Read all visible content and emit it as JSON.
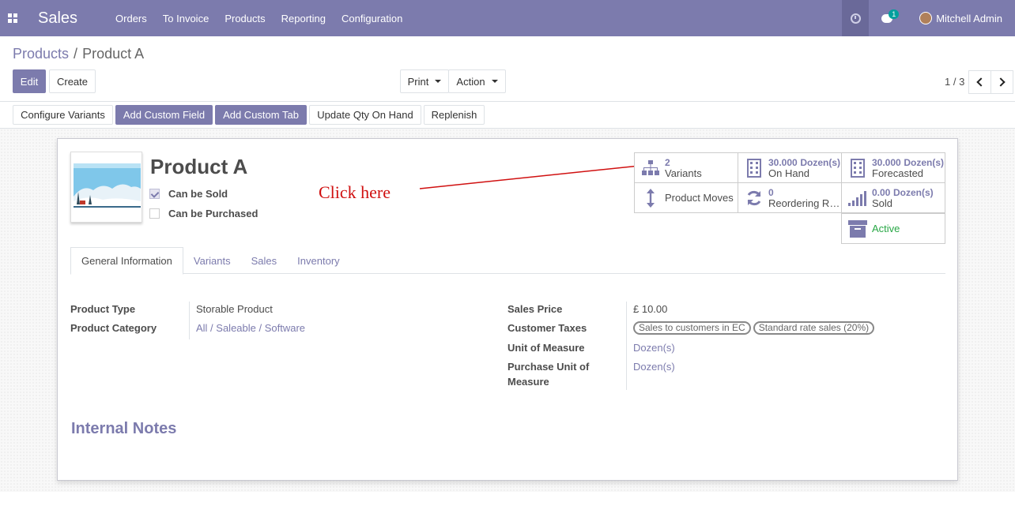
{
  "navbar": {
    "app_title": "Sales",
    "menu": [
      "Orders",
      "To Invoice",
      "Products",
      "Reporting",
      "Configuration"
    ],
    "chat_count": "1",
    "user_name": "Mitchell Admin"
  },
  "breadcrumb": {
    "parent": "Products",
    "separator": "/",
    "current": "Product A"
  },
  "buttons": {
    "edit": "Edit",
    "create": "Create",
    "print": "Print",
    "action": "Action"
  },
  "pager": {
    "text": "1 / 3"
  },
  "action_buttons": {
    "configure_variants": "Configure Variants",
    "add_custom_field": "Add Custom Field",
    "add_custom_tab": "Add Custom Tab",
    "update_qty": "Update Qty On Hand",
    "replenish": "Replenish"
  },
  "product": {
    "name": "Product A",
    "can_be_sold_label": "Can be Sold",
    "can_be_sold": true,
    "can_be_purchased_label": "Can be Purchased",
    "can_be_purchased": false
  },
  "annotation": {
    "text": "Click here"
  },
  "smart_buttons": {
    "variants": {
      "value": "2",
      "label": "Variants"
    },
    "on_hand": {
      "value": "30.000",
      "unit": "Dozen(s)",
      "label": "On Hand"
    },
    "forecasted": {
      "value": "30.000",
      "unit": "Dozen(s)",
      "label": "Forecasted"
    },
    "product_moves": {
      "label": "Product Moves"
    },
    "reordering": {
      "value": "0",
      "label": "Reordering Rules"
    },
    "sold": {
      "value": "0.00",
      "unit": "Dozen(s)",
      "label": "Sold"
    },
    "active": {
      "label": "Active"
    }
  },
  "tabs": [
    "General Information",
    "Variants",
    "Sales",
    "Inventory"
  ],
  "fields": {
    "product_type": {
      "label": "Product Type",
      "value": "Storable Product"
    },
    "product_category": {
      "label": "Product Category",
      "value": "All / Saleable / Software"
    },
    "sales_price": {
      "label": "Sales Price",
      "value": "£ 10.00"
    },
    "customer_taxes": {
      "label": "Customer Taxes",
      "tags": [
        "Sales to customers in EC",
        "Standard rate sales (20%)"
      ]
    },
    "uom": {
      "label": "Unit of Measure",
      "value": "Dozen(s)"
    },
    "purchase_uom": {
      "label_line1": "Purchase Unit of",
      "label_line2": "Measure",
      "value": "Dozen(s)"
    }
  },
  "notes": {
    "title": "Internal Notes"
  },
  "colors": {
    "brand": "#7c7bad",
    "annotation": "#d01010",
    "active": "#28a745"
  }
}
